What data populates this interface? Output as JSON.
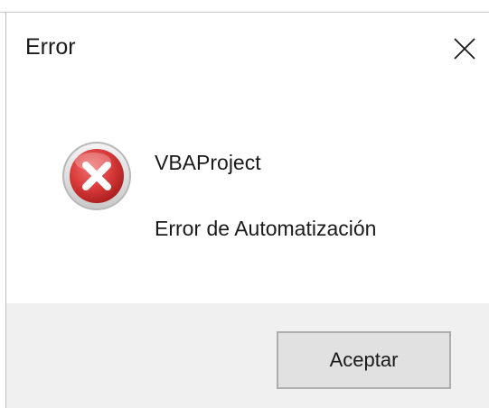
{
  "window": {
    "title": "Error",
    "close_icon": "close-icon"
  },
  "content": {
    "icon": "error-icon",
    "app_name": "VBAProject",
    "message": "Error de Automatización"
  },
  "footer": {
    "ok_label": "Aceptar"
  },
  "colors": {
    "error_red": "#d93a3a",
    "footer_bg": "#f0f0f0",
    "button_bg": "#e1e1e1"
  }
}
